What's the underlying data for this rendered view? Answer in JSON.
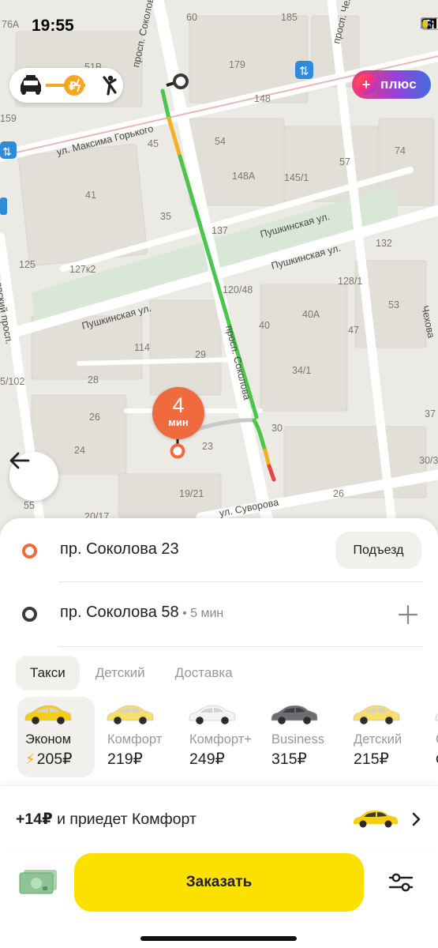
{
  "status_bar": {
    "time": "19:55",
    "icons": [
      "signal-icon",
      "location-icon",
      "wifi-icon",
      "battery-icon"
    ]
  },
  "map": {
    "streets": [
      "просп. Соколова",
      "ул. Максима Горького",
      "Пушкинская ул.",
      "Пушкинская ул.",
      "Пушкинская ул.",
      "просп. Соколова",
      "ул. Суворова",
      "просп. Чехова",
      "Чехова",
      "овский просп."
    ],
    "building_numbers": [
      "76А",
      "60",
      "185",
      "51В",
      "179",
      "159",
      "148",
      "45",
      "54",
      "74",
      "57",
      "41",
      "148А",
      "145/1",
      "35",
      "137",
      "132",
      "125",
      "127к2",
      "120/48",
      "128/1",
      "53",
      "40",
      "40А",
      "47",
      "114",
      "29",
      "5/102",
      "28",
      "34/1",
      "26",
      "30",
      "37",
      "24",
      "23",
      "30/3",
      "55",
      "19/21",
      "26",
      "20/17"
    ],
    "eta_value": "4",
    "eta_unit": "мин",
    "plus_label": "плюс",
    "route_colors": {
      "jam": "#e8453c",
      "slow": "#f2b027",
      "free": "#4cc54e",
      "walk": "#c9c9c9"
    }
  },
  "route": {
    "from": "пр. Соколова 23",
    "entrance_button": "Подъезд",
    "to": "пр. Соколова 58",
    "to_eta": " • 5 мин"
  },
  "tabs": [
    {
      "label": "Такси",
      "active": true
    },
    {
      "label": "Детский",
      "active": false
    },
    {
      "label": "Доставка",
      "active": false
    }
  ],
  "tariffs": [
    {
      "name": "Эконом",
      "price": "205₽",
      "active": true,
      "car_color": "#f5cc16",
      "surge": true
    },
    {
      "name": "Комфорт",
      "price": "219₽",
      "active": false,
      "car_color": "#f7dd6a"
    },
    {
      "name": "Комфорт+",
      "price": "249₽",
      "active": false,
      "car_color": "#f4f4f4"
    },
    {
      "name": "Business",
      "price": "315₽",
      "active": false,
      "car_color": "#6d6e72"
    },
    {
      "name": "Детский",
      "price": "215₽",
      "active": false,
      "car_color": "#f7dd6a"
    },
    {
      "name": "С",
      "price": "с",
      "active": false,
      "car_color": "#f4f4f4"
    }
  ],
  "upsell": {
    "amount": "+14₽",
    "text": " и приедет Комфорт"
  },
  "order_button": "Заказать",
  "colors": {
    "accent": "#fce000",
    "pin": "#ef6a3c",
    "surge": "#f5a623"
  }
}
